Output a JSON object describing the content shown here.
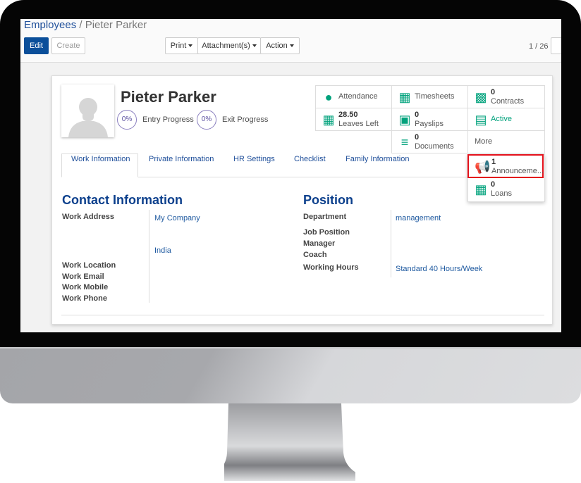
{
  "breadcrumb": {
    "parent": "Employees",
    "separator": "/",
    "current": "Pieter Parker"
  },
  "toolbar": {
    "edit": "Edit",
    "create": "Create",
    "print": "Print",
    "attachments": "Attachment(s)",
    "action": "Action",
    "pager": "1 / 26"
  },
  "employee": {
    "name": "Pieter Parker",
    "entry_progress": "0%",
    "entry_label": "Entry Progress",
    "exit_progress": "0%",
    "exit_label": "Exit Progress"
  },
  "smart_buttons": {
    "attendance": {
      "label": "Attendance",
      "icon": "user-icon"
    },
    "timesheets": {
      "label": "Timesheets",
      "icon": "calendar-icon"
    },
    "contracts": {
      "count": "0",
      "label": "Contracts",
      "icon": "book-icon"
    },
    "leaves": {
      "count": "28.50",
      "label": "Leaves Left",
      "icon": "calendar-icon"
    },
    "payslips": {
      "count": "0",
      "label": "Payslips",
      "icon": "money-icon"
    },
    "active": {
      "label": "Active",
      "icon": "archive-icon"
    },
    "documents": {
      "count": "0",
      "label": "Documents",
      "icon": "list-ol-icon"
    },
    "more": {
      "label": "More"
    },
    "announcements": {
      "count": "1",
      "label": "Announceme...",
      "icon": "bullhorn-icon"
    },
    "loans": {
      "count": "0",
      "label": "Loans",
      "icon": "calendar-icon"
    }
  },
  "tabs": [
    "Work Information",
    "Private Information",
    "HR Settings",
    "Checklist",
    "Family Information"
  ],
  "contact": {
    "title": "Contact Information",
    "work_address_label": "Work Address",
    "work_address": "My Company",
    "country": "India",
    "work_location": "Work Location",
    "work_email": "Work Email",
    "work_mobile": "Work Mobile",
    "work_phone": "Work Phone"
  },
  "position": {
    "title": "Position",
    "department_label": "Department",
    "department": "management",
    "job_position": "Job Position",
    "manager": "Manager",
    "coach": "Coach",
    "working_hours_label": "Working Hours",
    "working_hours": "Standard 40 Hours/Week"
  },
  "colors": {
    "accent": "#00a27c",
    "primary": "#0b4f9a",
    "highlight": "#e3101a"
  }
}
